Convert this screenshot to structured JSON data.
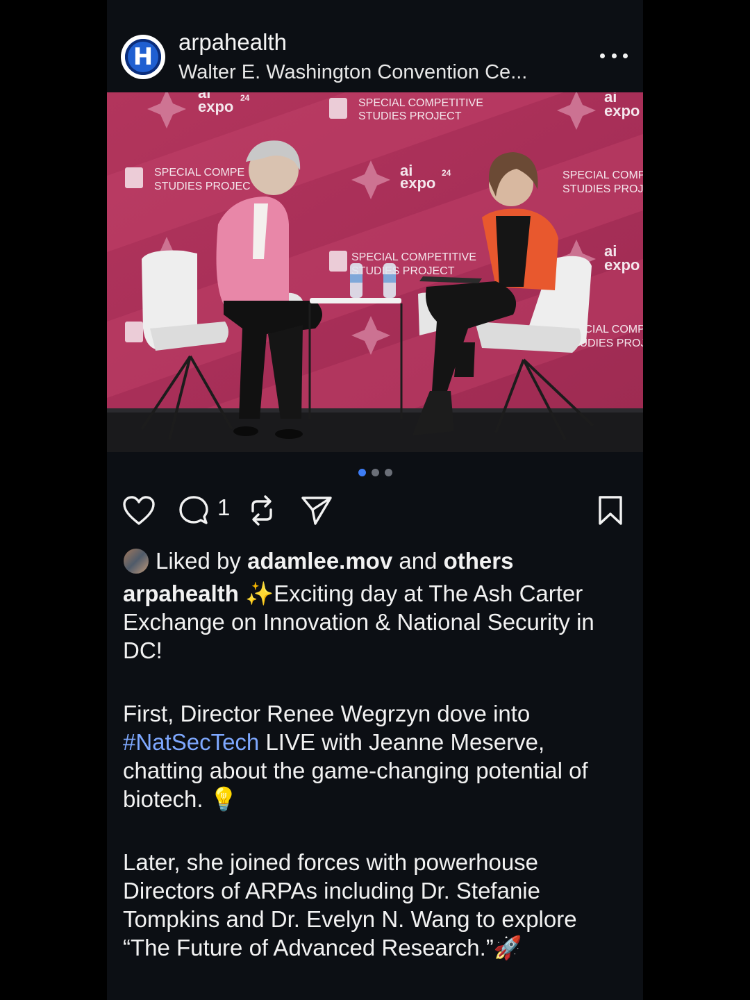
{
  "post": {
    "username": "arpahealth",
    "location": "Walter E. Washington Convention Ce...",
    "avatar_letter": "H",
    "photo_text": {
      "special_line1": "SPECIAL COMPETITIVE",
      "special_line2": "STUDIES PROJECT",
      "special_cut1": "SPECIAL COMPE",
      "special_cut2": "STUDIES PROJEC",
      "special_right1": "SPECIAL COMP",
      "special_right2": "STUDIES PROJE",
      "special_lower_right1": "PECIAL COMPE",
      "special_lower_right2": "STUDIES PROJE",
      "ai": "ai",
      "expo": "expo",
      "year": "24"
    },
    "carousel": {
      "count": 3,
      "active_index": 0
    },
    "comment_count": "1",
    "liked_by": {
      "prefix": "Liked by",
      "user": "adamlee.mov",
      "conj": "and",
      "others": "others"
    },
    "caption": {
      "author": "arpahealth",
      "p1": "✨Exciting day at The Ash Carter Exchange on Innovation & National Security in DC!",
      "p2_a": "First, Director Renee Wegrzyn dove into",
      "p2_hashtag": "#NatSecTech",
      "p2_b": "LIVE with Jeanne Meserve, chatting about the game-changing potential of biotech. 💡",
      "p3": "Later, she joined forces with powerhouse Directors of ARPAs including Dr. Stefanie Tompkins and Dr. Evelyn N. Wang to explore “The Future of Advanced Research.”🚀"
    }
  },
  "icons": [
    "more-icon",
    "heart-icon",
    "comment-icon",
    "repost-icon",
    "share-icon",
    "bookmark-icon"
  ],
  "colors": {
    "background": "#0c0f14",
    "hashtag": "#7ea8ff",
    "active_dot": "#3d7cf4",
    "backdrop": "#b2355c"
  }
}
